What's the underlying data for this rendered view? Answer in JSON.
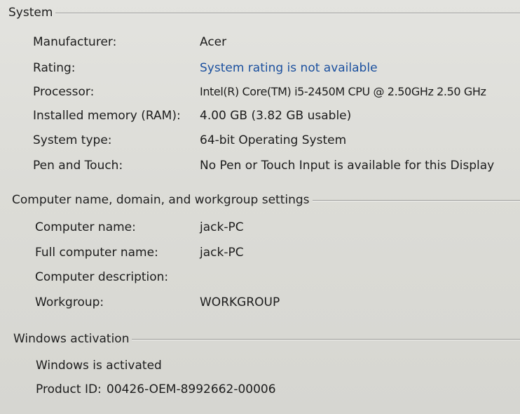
{
  "system": {
    "title": "System",
    "rows": [
      {
        "label": "Manufacturer:",
        "value": "Acer"
      },
      {
        "label": "Rating:",
        "value": "System rating is not available"
      },
      {
        "label": "Processor:",
        "value": "Intel(R) Core(TM) i5-2450M CPU @ 2.50GHz   2.50 GHz"
      },
      {
        "label": "Installed memory (RAM):",
        "value": "4.00 GB (3.82 GB usable)"
      },
      {
        "label": "System type:",
        "value": "64-bit Operating System"
      },
      {
        "label": "Pen and Touch:",
        "value": "No Pen or Touch Input is available for this Display"
      }
    ]
  },
  "computer": {
    "title": "Computer name, domain, and workgroup settings",
    "rows": [
      {
        "label": "Computer name:",
        "value": "jack-PC"
      },
      {
        "label": "Full computer name:",
        "value": "jack-PC"
      },
      {
        "label": "Computer description:",
        "value": ""
      },
      {
        "label": "Workgroup:",
        "value": "WORKGROUP"
      }
    ]
  },
  "activation": {
    "title": "Windows activation",
    "status": "Windows is activated",
    "product_id_label": "Product ID:",
    "product_id": "00426-OEM-8992662-00006"
  },
  "colors": {
    "link": "#1a4f9e",
    "text": "#1c1c1c",
    "background": "#dcdcd7"
  }
}
